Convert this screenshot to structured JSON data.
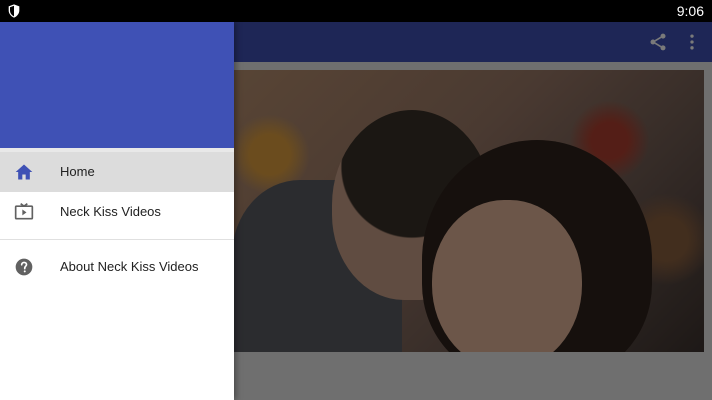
{
  "status_bar": {
    "time": "9:06",
    "left_icon": "shield-icon"
  },
  "app_bar": {
    "actions": [
      {
        "icon": "share-icon"
      },
      {
        "icon": "overflow-menu-icon"
      }
    ]
  },
  "drawer": {
    "items": [
      {
        "label": "Home",
        "icon": "home-icon",
        "active": true
      },
      {
        "label": "Neck Kiss Videos",
        "icon": "video-player-icon",
        "active": false
      },
      {
        "label": "About Neck Kiss Videos",
        "icon": "help-circle-icon",
        "active": false
      }
    ]
  },
  "colors": {
    "primary": "#3f51b5",
    "status_bar": "#000000",
    "active_item_bg": "#dcdcdc",
    "icon_home": "#3f51b5",
    "icon_grey": "#616161"
  }
}
